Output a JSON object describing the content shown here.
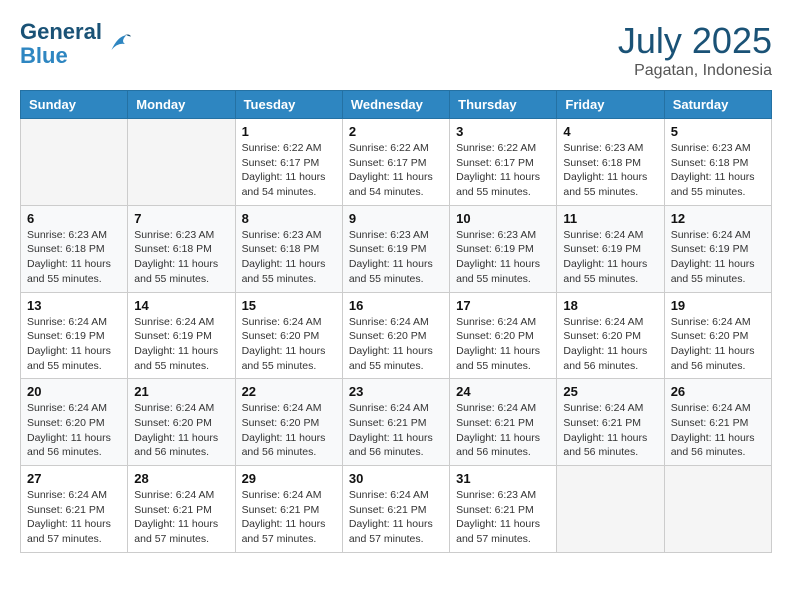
{
  "header": {
    "logo_line1": "General",
    "logo_line2": "Blue",
    "month": "July 2025",
    "location": "Pagatan, Indonesia"
  },
  "days_of_week": [
    "Sunday",
    "Monday",
    "Tuesday",
    "Wednesday",
    "Thursday",
    "Friday",
    "Saturday"
  ],
  "weeks": [
    [
      {
        "day": "",
        "info": ""
      },
      {
        "day": "",
        "info": ""
      },
      {
        "day": "1",
        "info": "Sunrise: 6:22 AM\nSunset: 6:17 PM\nDaylight: 11 hours and 54 minutes."
      },
      {
        "day": "2",
        "info": "Sunrise: 6:22 AM\nSunset: 6:17 PM\nDaylight: 11 hours and 54 minutes."
      },
      {
        "day": "3",
        "info": "Sunrise: 6:22 AM\nSunset: 6:17 PM\nDaylight: 11 hours and 55 minutes."
      },
      {
        "day": "4",
        "info": "Sunrise: 6:23 AM\nSunset: 6:18 PM\nDaylight: 11 hours and 55 minutes."
      },
      {
        "day": "5",
        "info": "Sunrise: 6:23 AM\nSunset: 6:18 PM\nDaylight: 11 hours and 55 minutes."
      }
    ],
    [
      {
        "day": "6",
        "info": "Sunrise: 6:23 AM\nSunset: 6:18 PM\nDaylight: 11 hours and 55 minutes."
      },
      {
        "day": "7",
        "info": "Sunrise: 6:23 AM\nSunset: 6:18 PM\nDaylight: 11 hours and 55 minutes."
      },
      {
        "day": "8",
        "info": "Sunrise: 6:23 AM\nSunset: 6:18 PM\nDaylight: 11 hours and 55 minutes."
      },
      {
        "day": "9",
        "info": "Sunrise: 6:23 AM\nSunset: 6:19 PM\nDaylight: 11 hours and 55 minutes."
      },
      {
        "day": "10",
        "info": "Sunrise: 6:23 AM\nSunset: 6:19 PM\nDaylight: 11 hours and 55 minutes."
      },
      {
        "day": "11",
        "info": "Sunrise: 6:24 AM\nSunset: 6:19 PM\nDaylight: 11 hours and 55 minutes."
      },
      {
        "day": "12",
        "info": "Sunrise: 6:24 AM\nSunset: 6:19 PM\nDaylight: 11 hours and 55 minutes."
      }
    ],
    [
      {
        "day": "13",
        "info": "Sunrise: 6:24 AM\nSunset: 6:19 PM\nDaylight: 11 hours and 55 minutes."
      },
      {
        "day": "14",
        "info": "Sunrise: 6:24 AM\nSunset: 6:19 PM\nDaylight: 11 hours and 55 minutes."
      },
      {
        "day": "15",
        "info": "Sunrise: 6:24 AM\nSunset: 6:20 PM\nDaylight: 11 hours and 55 minutes."
      },
      {
        "day": "16",
        "info": "Sunrise: 6:24 AM\nSunset: 6:20 PM\nDaylight: 11 hours and 55 minutes."
      },
      {
        "day": "17",
        "info": "Sunrise: 6:24 AM\nSunset: 6:20 PM\nDaylight: 11 hours and 55 minutes."
      },
      {
        "day": "18",
        "info": "Sunrise: 6:24 AM\nSunset: 6:20 PM\nDaylight: 11 hours and 56 minutes."
      },
      {
        "day": "19",
        "info": "Sunrise: 6:24 AM\nSunset: 6:20 PM\nDaylight: 11 hours and 56 minutes."
      }
    ],
    [
      {
        "day": "20",
        "info": "Sunrise: 6:24 AM\nSunset: 6:20 PM\nDaylight: 11 hours and 56 minutes."
      },
      {
        "day": "21",
        "info": "Sunrise: 6:24 AM\nSunset: 6:20 PM\nDaylight: 11 hours and 56 minutes."
      },
      {
        "day": "22",
        "info": "Sunrise: 6:24 AM\nSunset: 6:20 PM\nDaylight: 11 hours and 56 minutes."
      },
      {
        "day": "23",
        "info": "Sunrise: 6:24 AM\nSunset: 6:21 PM\nDaylight: 11 hours and 56 minutes."
      },
      {
        "day": "24",
        "info": "Sunrise: 6:24 AM\nSunset: 6:21 PM\nDaylight: 11 hours and 56 minutes."
      },
      {
        "day": "25",
        "info": "Sunrise: 6:24 AM\nSunset: 6:21 PM\nDaylight: 11 hours and 56 minutes."
      },
      {
        "day": "26",
        "info": "Sunrise: 6:24 AM\nSunset: 6:21 PM\nDaylight: 11 hours and 56 minutes."
      }
    ],
    [
      {
        "day": "27",
        "info": "Sunrise: 6:24 AM\nSunset: 6:21 PM\nDaylight: 11 hours and 57 minutes."
      },
      {
        "day": "28",
        "info": "Sunrise: 6:24 AM\nSunset: 6:21 PM\nDaylight: 11 hours and 57 minutes."
      },
      {
        "day": "29",
        "info": "Sunrise: 6:24 AM\nSunset: 6:21 PM\nDaylight: 11 hours and 57 minutes."
      },
      {
        "day": "30",
        "info": "Sunrise: 6:24 AM\nSunset: 6:21 PM\nDaylight: 11 hours and 57 minutes."
      },
      {
        "day": "31",
        "info": "Sunrise: 6:23 AM\nSunset: 6:21 PM\nDaylight: 11 hours and 57 minutes."
      },
      {
        "day": "",
        "info": ""
      },
      {
        "day": "",
        "info": ""
      }
    ]
  ]
}
